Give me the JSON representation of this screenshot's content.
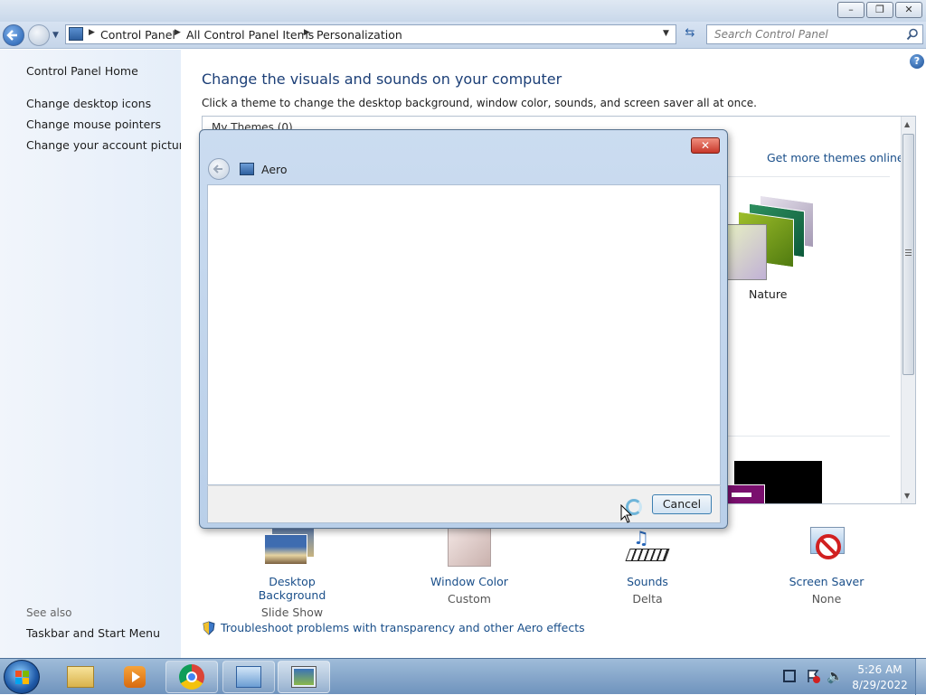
{
  "window": {
    "breadcrumb": [
      "Control Panel",
      "All Control Panel Items",
      "Personalization"
    ],
    "search_placeholder": "Search Control Panel"
  },
  "sidebar": {
    "home": "Control Panel Home",
    "links": [
      "Change desktop icons",
      "Change mouse pointers",
      "Change your account picture"
    ],
    "see_also_label": "See also",
    "see_also_links": [
      "Taskbar and Start Menu"
    ]
  },
  "main": {
    "title": "Change the visuals and sounds on your computer",
    "subtitle": "Click a theme to change the desktop background, window color, sounds, and screen saver all at once.",
    "my_themes_label": "My Themes (0)",
    "get_more": "Get more themes online",
    "nature_label": "Nature"
  },
  "settings": [
    {
      "title": "Desktop Background",
      "value": "Slide Show",
      "icon": "photos-icon"
    },
    {
      "title": "Window Color",
      "value": "Custom",
      "icon": "color-swatch-icon"
    },
    {
      "title": "Sounds",
      "value": "Delta",
      "icon": "music-icon"
    },
    {
      "title": "Screen Saver",
      "value": "None",
      "icon": "screensaver-icon"
    }
  ],
  "troubleshoot_link": "Troubleshoot problems with transparency and other Aero effects",
  "dialog": {
    "header": "Aero",
    "cancel": "Cancel"
  },
  "taskbar": {
    "time": "5:26 AM",
    "date": "8/29/2022"
  },
  "colors": {
    "link": "#1a4f8a",
    "heading": "#1c3f77"
  }
}
